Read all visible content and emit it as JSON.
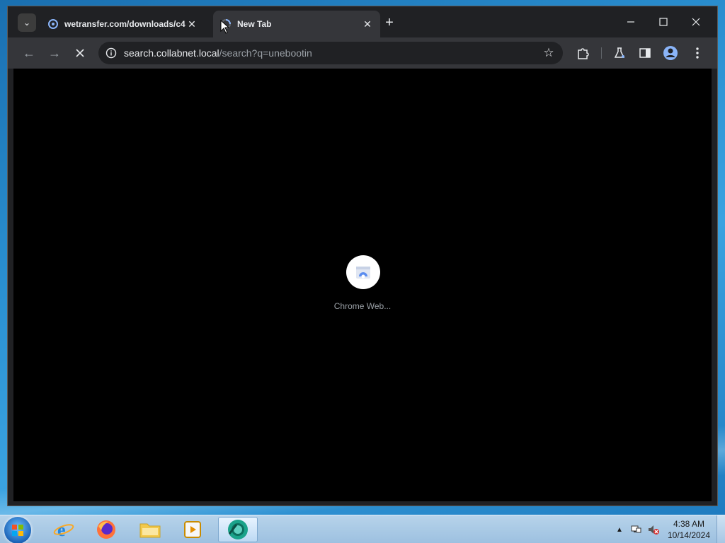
{
  "browser": {
    "tabs": [
      {
        "title": "wetransfer.com/downloads/c4",
        "active": false,
        "icon": "wetransfer-favicon"
      },
      {
        "title": "New Tab",
        "active": true,
        "icon": "loading-spinner-icon"
      }
    ],
    "new_tab_label": "+",
    "address": {
      "host": "search.collabnet.local",
      "path": "/search?q=unebootin"
    },
    "loading": true,
    "content": {
      "spinner_label": "Chrome Web..."
    }
  },
  "taskbar": {
    "apps": [
      "internet-explorer",
      "firefox",
      "file-explorer",
      "media-player",
      "chrome"
    ],
    "active_app": "chrome",
    "clock": {
      "time": "4:38 AM",
      "date": "10/14/2024"
    }
  },
  "colors": {
    "tab_strip": "#202124",
    "toolbar": "#35363a",
    "content": "#000000",
    "taskbar": "#a9c9e6"
  }
}
